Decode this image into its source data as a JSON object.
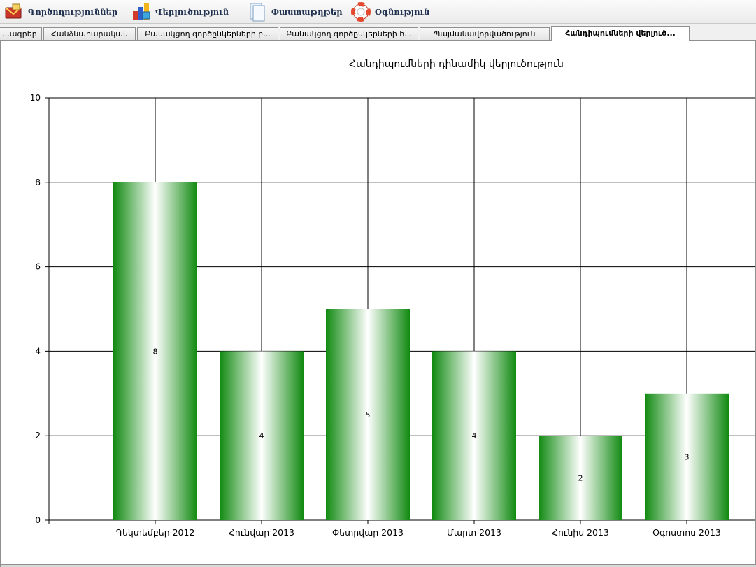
{
  "menu": {
    "items": [
      {
        "label": "Գործողություններ",
        "icon": "mail-icon"
      },
      {
        "label": "Վերլուծություն",
        "icon": "analytics-icon"
      },
      {
        "label": "Փաստաթղթեր",
        "icon": "documents-icon"
      },
      {
        "label": "Օգնություն",
        "icon": "lifebuoy-icon"
      }
    ]
  },
  "tabs": [
    {
      "label": "...ագրեր",
      "active": false
    },
    {
      "label": "Հանձնարարական",
      "active": false
    },
    {
      "label": "Բանակցող գործընկերների բ...",
      "active": false
    },
    {
      "label": "Բանակցող գործընկերների հ...",
      "active": false
    },
    {
      "label": "Պայմանավորվածություն",
      "active": false
    },
    {
      "label": "Հանդիպումների վերլուծ...",
      "active": true
    }
  ],
  "colors": {
    "bar_dark": "#108a10",
    "bar_light": "#ffffff",
    "grid": "#000000",
    "menu_text": "#20314f"
  },
  "chart_data": {
    "type": "bar",
    "title": "Հանդիպումների դինամիկ վերլուծություն",
    "categories": [
      "Դեկտեմբեր 2012",
      "Հունվար 2013",
      "Փետրվար 2013",
      "Մարտ 2013",
      "Հունիս 2013",
      "Օգոստոս 2013"
    ],
    "values": [
      8,
      4,
      5,
      4,
      2,
      3
    ],
    "data_labels": [
      "8",
      "4",
      "5",
      "4",
      "2",
      "3"
    ],
    "ylim": [
      0,
      10
    ],
    "yticks": [
      "0",
      "2",
      "4",
      "6",
      "8",
      "10"
    ],
    "xlabel": "",
    "ylabel": "",
    "grid": true,
    "legend": "none"
  }
}
